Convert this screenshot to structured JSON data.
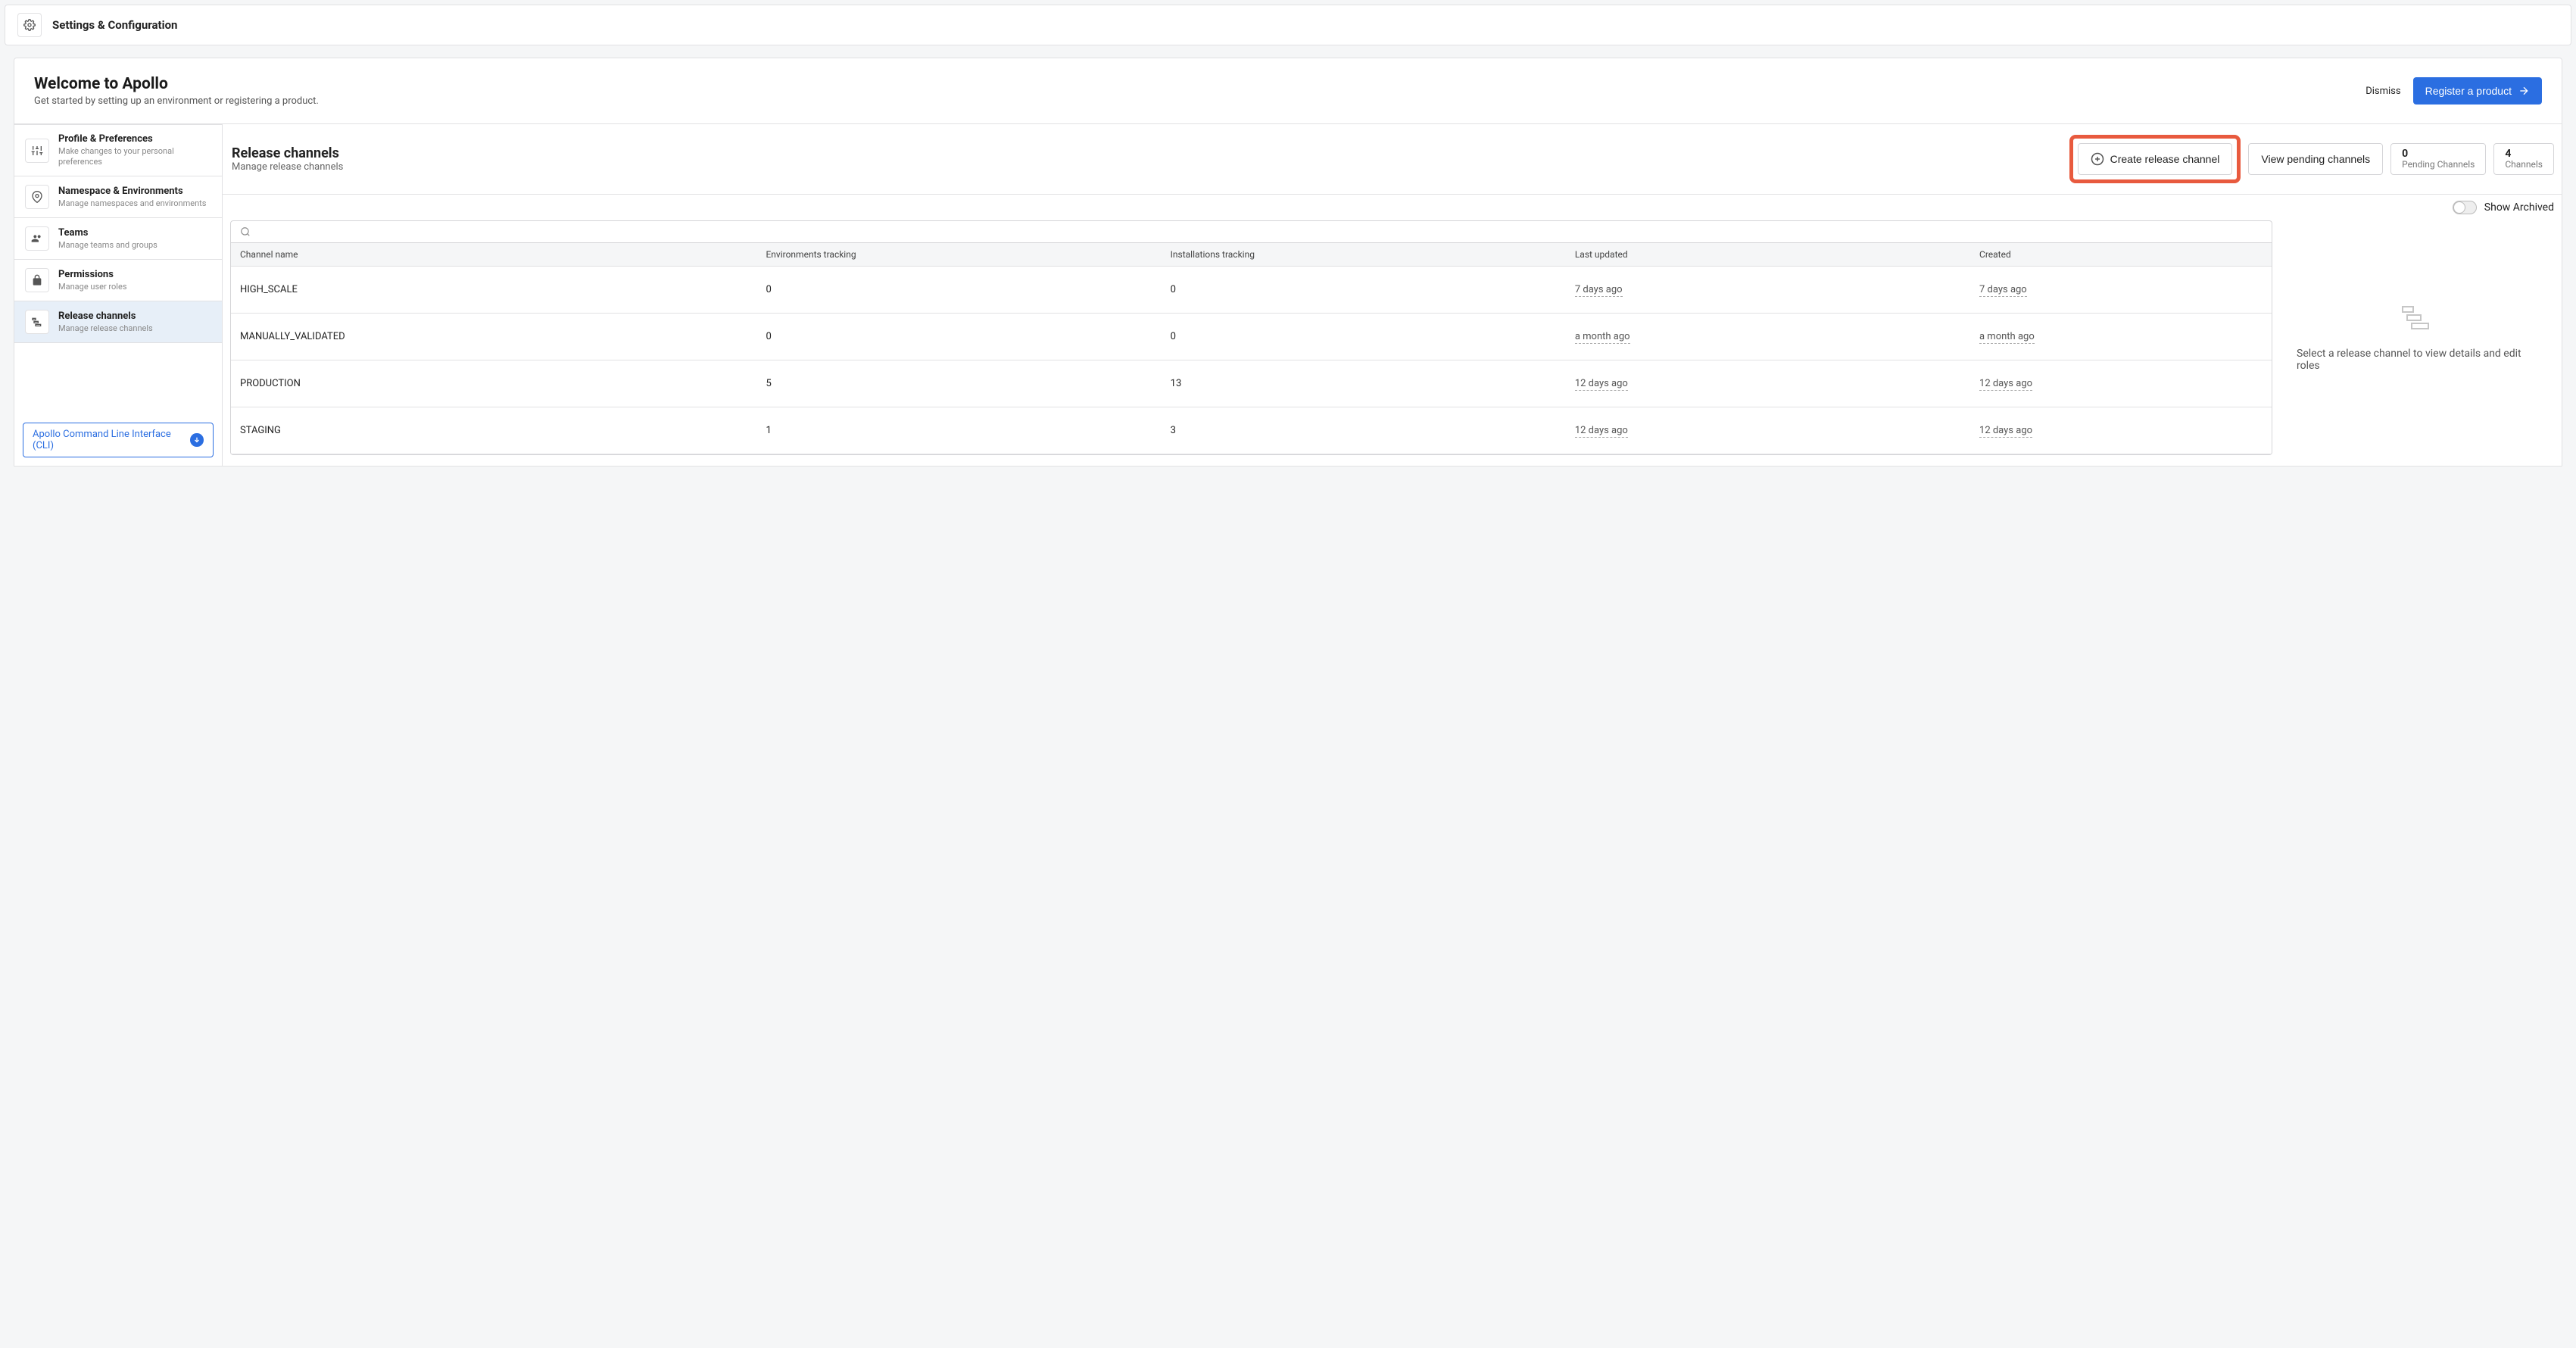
{
  "header": {
    "title": "Settings & Configuration"
  },
  "welcome": {
    "title": "Welcome to Apollo",
    "subtitle": "Get started by setting up an environment or registering a product.",
    "dismiss": "Dismiss",
    "register": "Register a product"
  },
  "sidebar": {
    "items": [
      {
        "label": "Profile & Preferences",
        "desc": "Make changes to your personal preferences",
        "icon": "sliders"
      },
      {
        "label": "Namespace & Environments",
        "desc": "Manage namespaces and environments",
        "icon": "location"
      },
      {
        "label": "Teams",
        "desc": "Manage teams and groups",
        "icon": "users"
      },
      {
        "label": "Permissions",
        "desc": "Manage user roles",
        "icon": "lock"
      },
      {
        "label": "Release channels",
        "desc": "Manage release channels",
        "icon": "channels"
      }
    ],
    "cli": "Apollo Command Line Interface (CLI)"
  },
  "content": {
    "title": "Release channels",
    "subtitle": "Manage release channels",
    "createBtn": "Create release channel",
    "pendingBtn": "View pending channels",
    "stats": [
      {
        "num": "0",
        "label": "Pending Channels"
      },
      {
        "num": "4",
        "label": "Channels"
      }
    ],
    "showArchived": "Show Archived",
    "columns": {
      "name": "Channel name",
      "env": "Environments tracking",
      "inst": "Installations tracking",
      "updated": "Last updated",
      "created": "Created"
    },
    "rows": [
      {
        "name": "HIGH_SCALE",
        "env": "0",
        "inst": "0",
        "updated": "7 days ago",
        "created": "7 days ago"
      },
      {
        "name": "MANUALLY_VALIDATED",
        "env": "0",
        "inst": "0",
        "updated": "a month ago",
        "created": "a month ago"
      },
      {
        "name": "PRODUCTION",
        "env": "5",
        "inst": "13",
        "updated": "12 days ago",
        "created": "12 days ago"
      },
      {
        "name": "STAGING",
        "env": "1",
        "inst": "3",
        "updated": "12 days ago",
        "created": "12 days ago"
      }
    ],
    "detailPlaceholder": "Select a release channel to view details and edit roles"
  }
}
